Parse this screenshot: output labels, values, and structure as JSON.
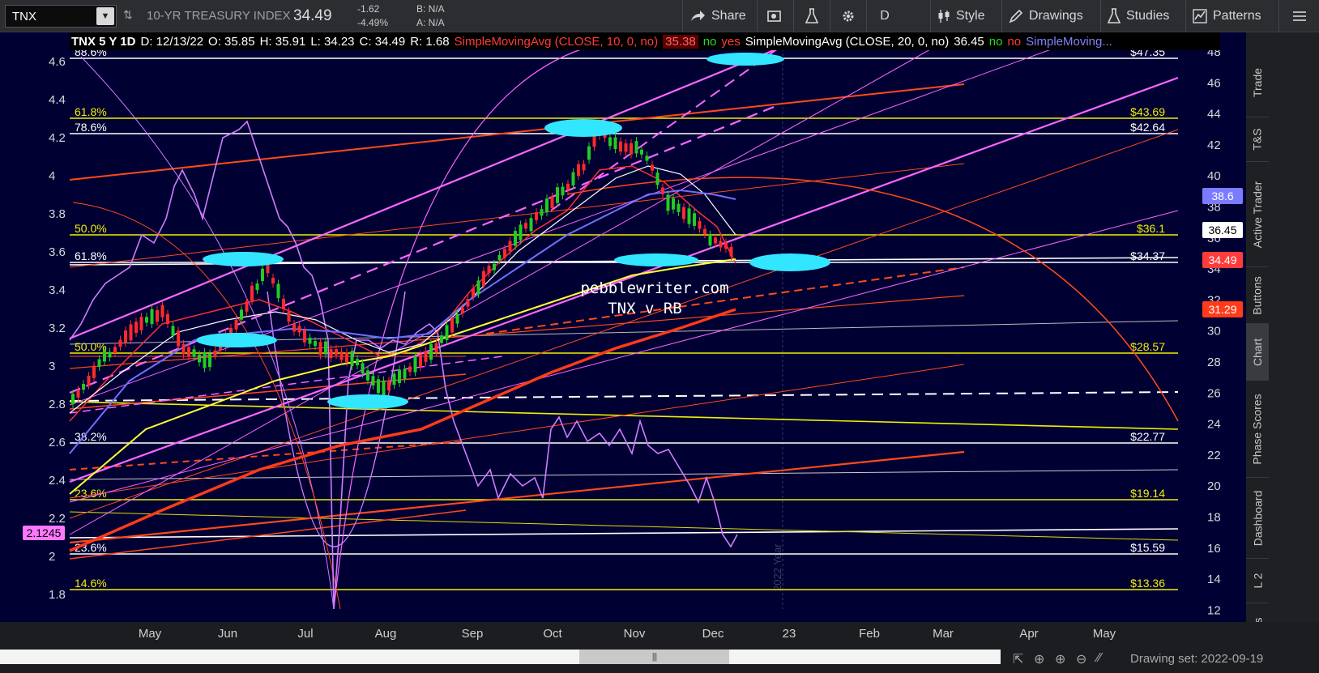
{
  "toolbar": {
    "symbol": "TNX",
    "title": "10-YR TREASURY INDEX",
    "last": "34.49",
    "change": "-1.62",
    "change_pct": "-4.49%",
    "bid": "B: N/A",
    "ask": "A: N/A",
    "share": "Share",
    "period": "D",
    "style": "Style",
    "drawings": "Drawings",
    "studies": "Studies",
    "patterns": "Patterns"
  },
  "legend": {
    "header": "TNX 5 Y 1D",
    "date": "D: 12/13/22",
    "open": "O: 35.85",
    "high": "H: 35.91",
    "low": "L: 34.23",
    "close": "C: 34.49",
    "range": "R: 1.68",
    "sma10_label": "SimpleMovingAvg (CLOSE, 10, 0, no)",
    "sma10_val": "35.38",
    "sma10_f1": "no",
    "sma10_f2": "yes",
    "sma20_label": "SimpleMovingAvg (CLOSE, 20, 0, no)",
    "sma20_val": "36.45",
    "sma20_f1": "no",
    "sma20_f2": "no",
    "sma_more": "SimpleMoving..."
  },
  "left_axis": {
    "ticks": [
      "4.6",
      "4.4",
      "4.2",
      "4",
      "3.8",
      "3.6",
      "3.4",
      "3.2",
      "3",
      "2.8",
      "2.6",
      "2.4",
      "2.2",
      "2",
      "1.8"
    ],
    "highlight": "2.1245"
  },
  "right_axis": {
    "ticks": [
      "48",
      "46",
      "44",
      "42",
      "40",
      "38",
      "36",
      "34",
      "32",
      "30",
      "28",
      "26",
      "24",
      "22",
      "20",
      "18",
      "16",
      "14",
      "12"
    ],
    "price_tags": [
      {
        "text": "38.6",
        "color": "#7b7bff"
      },
      {
        "text": "36.45",
        "color": "#ffffff"
      },
      {
        "text": "34.49",
        "color": "#ff3b3b"
      },
      {
        "text": "31.29",
        "color": "#ff3b1a"
      }
    ]
  },
  "fib_levels": [
    {
      "label": "88.6%",
      "value_label": "$47.35"
    },
    {
      "label": "61.8%",
      "value_label": "$43.69"
    },
    {
      "label": "78.6%",
      "value_label": "$42.64"
    },
    {
      "label": "50.0%",
      "value_label": "$36.1"
    },
    {
      "label": "61.8%",
      "value_label": "$34.37"
    },
    {
      "label": "50.0%",
      "value_label": "$28.57"
    },
    {
      "label": "38.2%",
      "value_label": "$22.77"
    },
    {
      "label": "23.6%",
      "value_label": "$19.14"
    },
    {
      "label": "23.6%",
      "value_label": "$15.59"
    },
    {
      "label": "14.6%",
      "value_label": "$13.36"
    }
  ],
  "annotations": {
    "site": "pebblewriter.com",
    "subtitle": "TNX v RB",
    "year_marker": "2022 Year"
  },
  "xaxis": {
    "ticks": [
      "May",
      "Jun",
      "Jul",
      "Aug",
      "Sep",
      "Oct",
      "Nov",
      "Dec",
      "23",
      "Feb",
      "Mar",
      "Apr",
      "May"
    ]
  },
  "side_tabs": [
    "Trade",
    "T&S",
    "Active Trader",
    "Buttons",
    "Chart",
    "Phase Scores",
    "Dashboard",
    "L 2",
    "News"
  ],
  "bottom": {
    "drawing_set": "Drawing set: 2022-09-19",
    "scroll_grip": "|||"
  },
  "colors": {
    "chart_bg": "#000033",
    "fib_yellow": "#f0f000",
    "fib_white": "#ffffff",
    "trend_orange": "#ff4a1a",
    "channel_pink": "#ff66ff",
    "rb_purple": "#d07cff",
    "highlight_cyan": "#33e6ff",
    "up_candle": "#22cc22",
    "down_candle": "#ff2a2a"
  }
}
